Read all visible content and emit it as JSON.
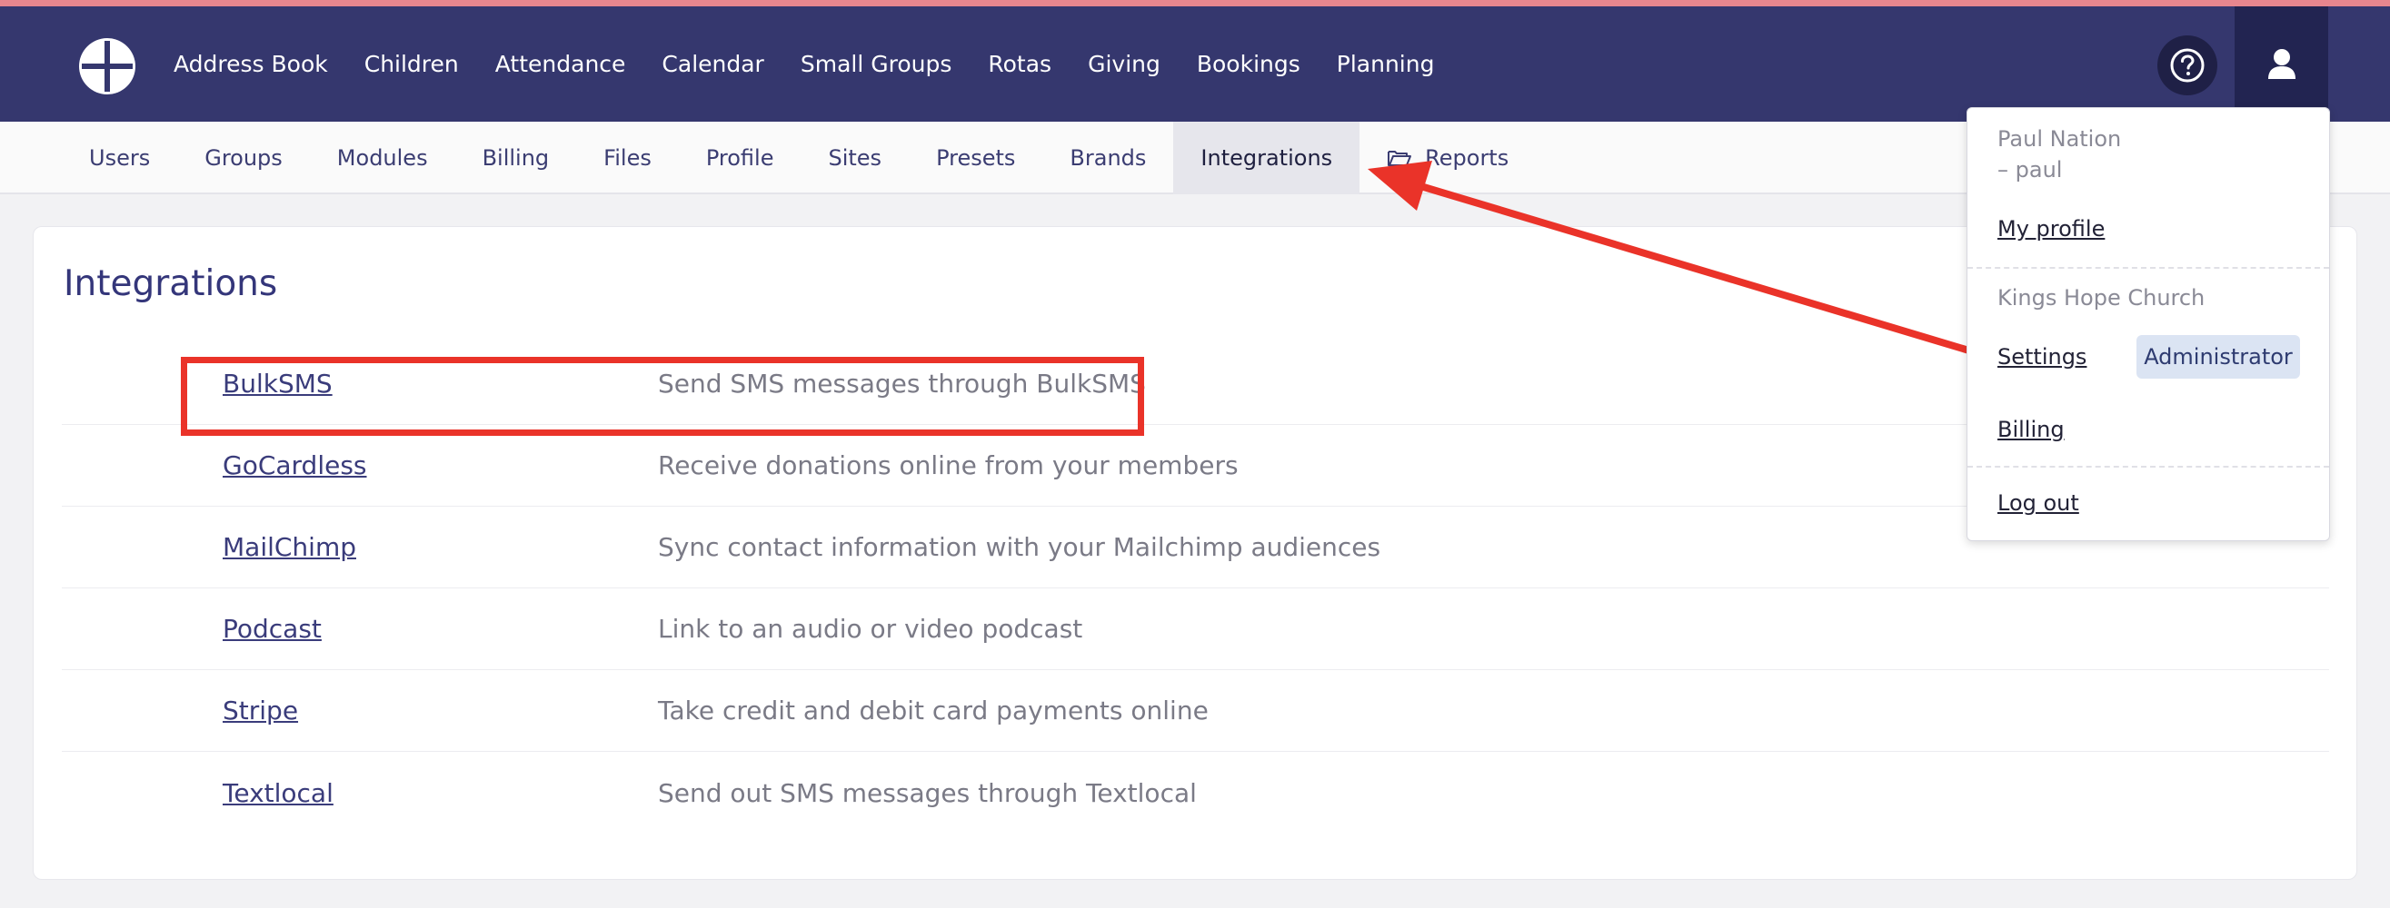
{
  "top_nav": {
    "items": [
      "Address Book",
      "Children",
      "Attendance",
      "Calendar",
      "Small Groups",
      "Rotas",
      "Giving",
      "Bookings",
      "Planning"
    ]
  },
  "sub_nav": {
    "items": [
      "Users",
      "Groups",
      "Modules",
      "Billing",
      "Files",
      "Profile",
      "Sites",
      "Presets",
      "Brands",
      "Integrations",
      "Reports"
    ],
    "active": "Integrations"
  },
  "page": {
    "title": "Integrations"
  },
  "integrations": [
    {
      "name": "BulkSMS",
      "description": "Send SMS messages through BulkSMS"
    },
    {
      "name": "GoCardless",
      "description": "Receive donations online from your members"
    },
    {
      "name": "MailChimp",
      "description": "Sync contact information with your Mailchimp audiences"
    },
    {
      "name": "Podcast",
      "description": "Link to an audio or video podcast"
    },
    {
      "name": "Stripe",
      "description": "Take credit and debit card payments online"
    },
    {
      "name": "Textlocal",
      "description": "Send out SMS messages through Textlocal"
    }
  ],
  "user_menu": {
    "user_name": "Paul Nation",
    "username": "– paul",
    "my_profile": "My profile",
    "church": "Kings Hope Church",
    "settings": "Settings",
    "role_badge": "Administrator",
    "billing": "Billing",
    "logout": "Log out"
  },
  "colors": {
    "nav_bg": "#35376e",
    "accent_line": "#e7868e",
    "annotation_red": "#ea3329",
    "badge_bg": "#dbe4f3"
  },
  "icons": {
    "logo": "cross-circle-logo",
    "help": "question-circle-icon",
    "user": "person-icon",
    "reports": "folder-open-icon"
  }
}
